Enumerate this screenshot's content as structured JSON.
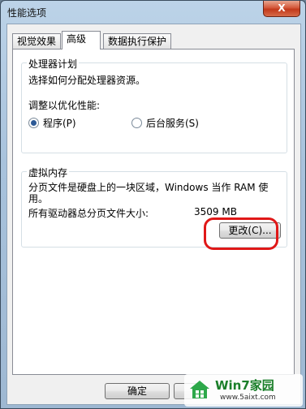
{
  "window": {
    "title": "性能选项",
    "close_label": "X"
  },
  "tabs": [
    {
      "label": "视觉效果",
      "active": false
    },
    {
      "label": "高级",
      "active": true
    },
    {
      "label": "数据执行保护",
      "active": false
    }
  ],
  "processor": {
    "group_title": "处理器计划",
    "description": "选择如何分配处理器资源。",
    "adjust_label": "调整以优化性能:",
    "options": [
      {
        "label": "程序(P)",
        "checked": true
      },
      {
        "label": "后台服务(S)",
        "checked": false
      }
    ]
  },
  "virtual_memory": {
    "group_title": "虚拟内存",
    "description_line1": "分页文件是硬盘上的一块区域，Windows 当作 RAM 使",
    "description_line2": "用。",
    "total_label": "所有驱动器总分页文件大小:",
    "total_value": "3509 MB",
    "change_button": "更改(C)..."
  },
  "footer": {
    "ok_button": "确定"
  },
  "watermark": {
    "brand": "Win7家园",
    "url": "www.5aixt.com"
  },
  "colors": {
    "highlight": "#e01818",
    "close": "#c2391b"
  }
}
